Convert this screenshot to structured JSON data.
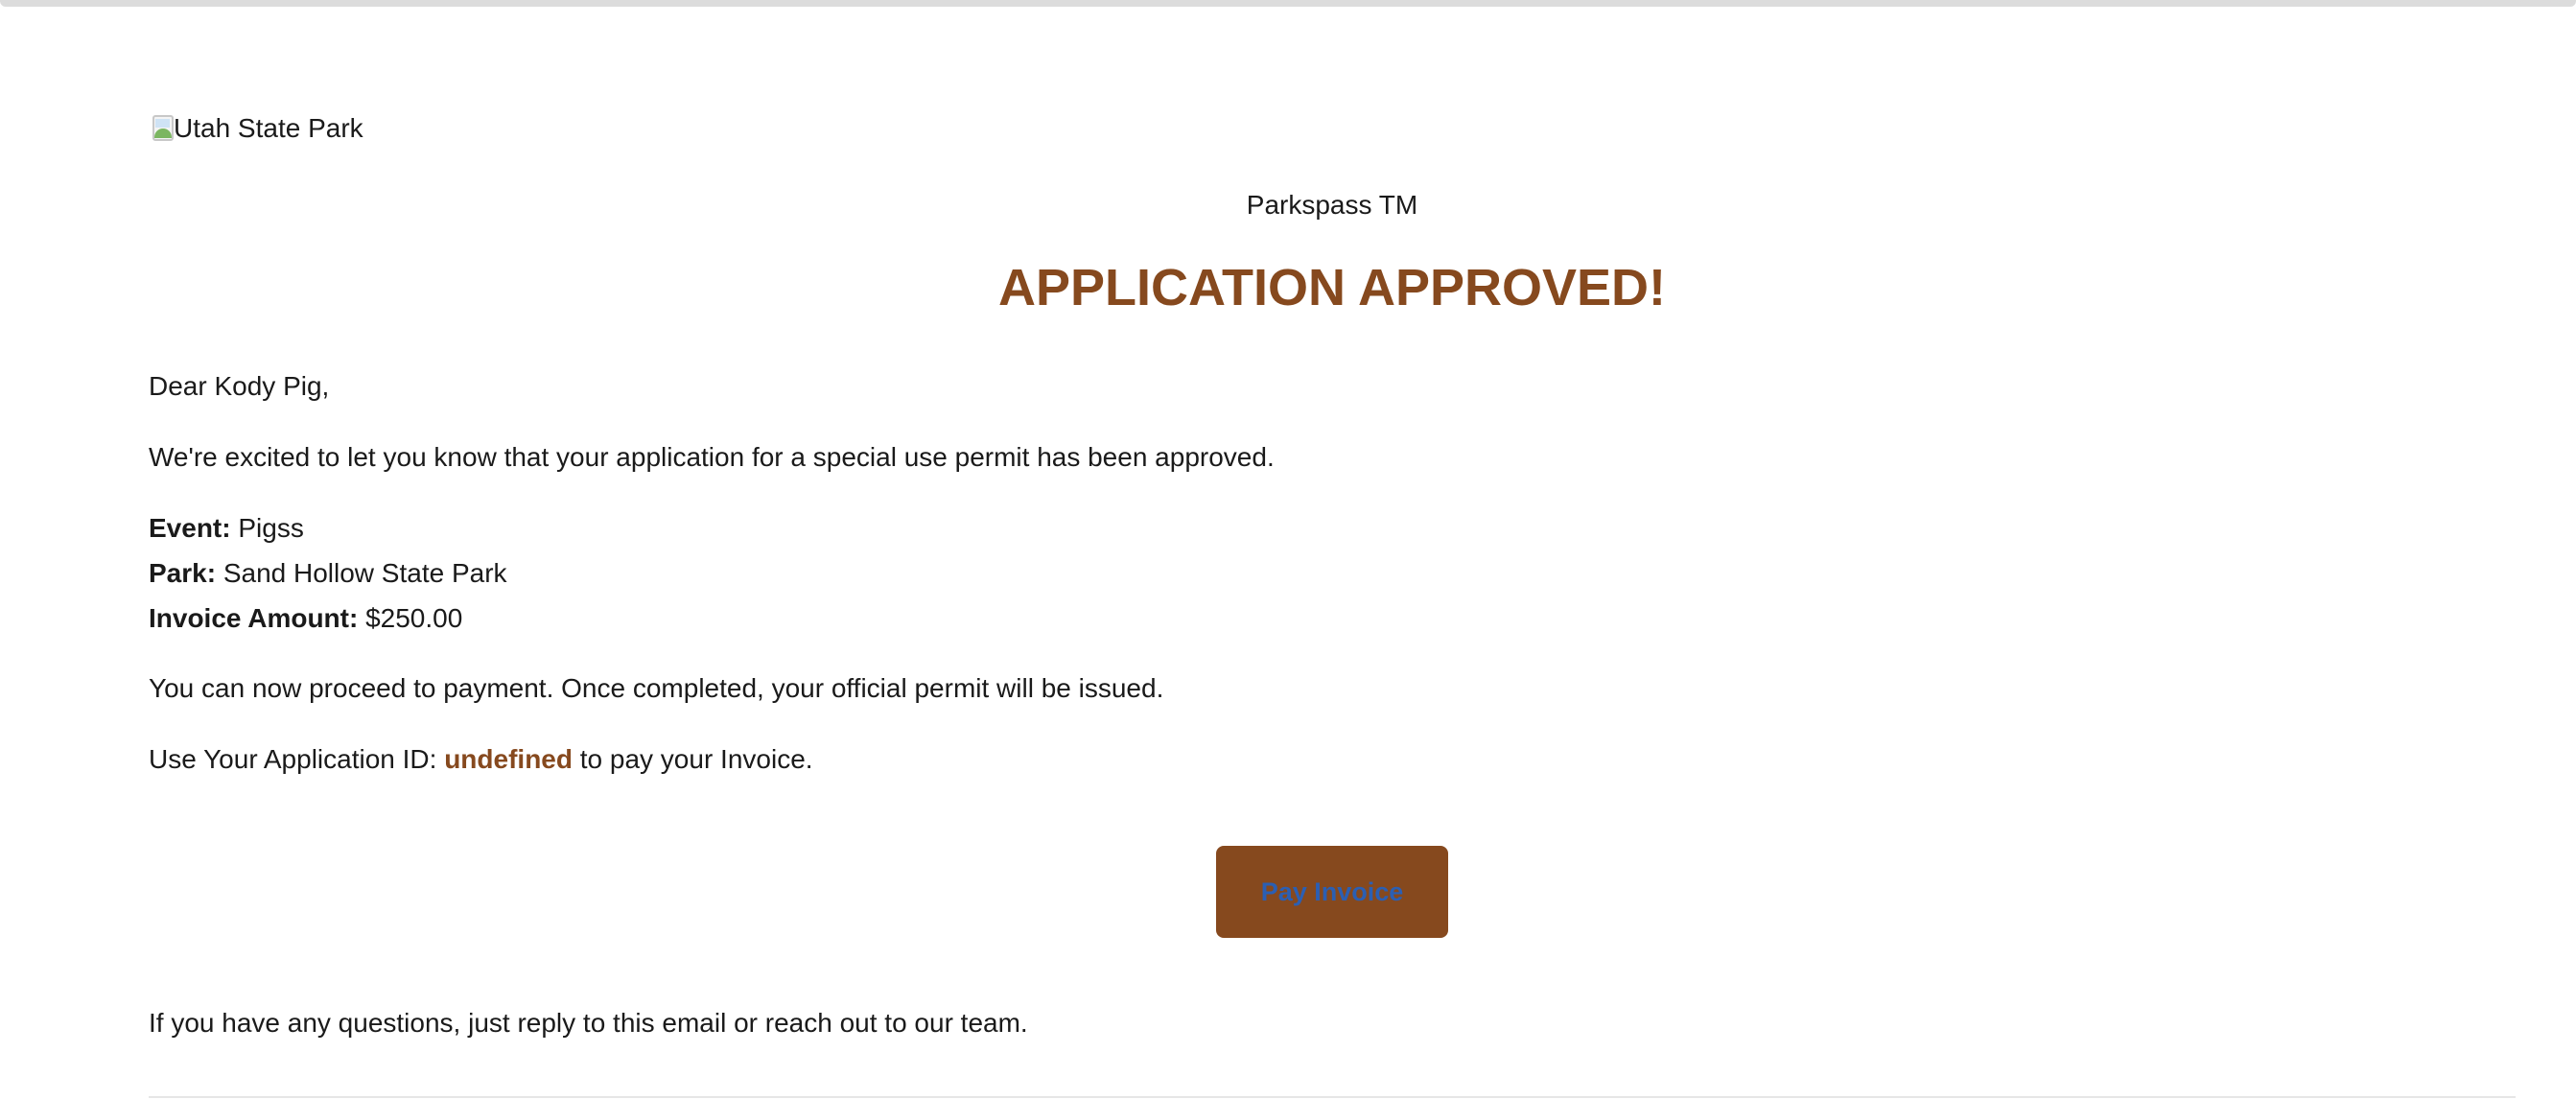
{
  "header": {
    "logo_alt": "Utah State Park",
    "brand": "Parkspass TM",
    "headline": "APPLICATION APPROVED!"
  },
  "body": {
    "greeting": "Dear Kody Pig,",
    "intro": "We're excited to let you know that your application for a special use permit has been approved.",
    "details": {
      "event_label": "Event:",
      "event_value": "Pigss",
      "park_label": "Park:",
      "park_value": "Sand Hollow State Park",
      "amount_label": "Invoice Amount:",
      "amount_value": "$250.00"
    },
    "proceed": "You can now proceed to payment. Once completed, your official permit will be issued.",
    "app_id_prefix": "Use Your Application ID:",
    "app_id_value": "undefined",
    "app_id_suffix": "to pay your Invoice.",
    "pay_button": "Pay Invoice",
    "closing": "If you have any questions, just reply to this email or reach out to our team."
  },
  "colors": {
    "accent": "#86491e",
    "button_text": "#2b5fb3",
    "divider": "#e6e6e6"
  },
  "icons": {
    "logo": "broken-image-icon"
  }
}
